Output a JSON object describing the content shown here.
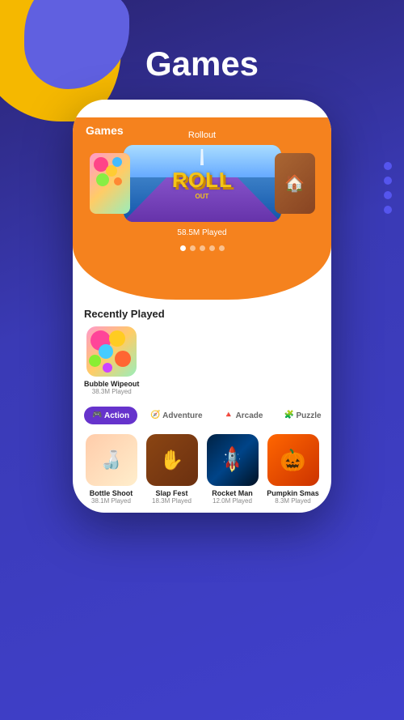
{
  "page": {
    "title": "Games",
    "background": "#3a3ab5"
  },
  "featured": {
    "game_label": "Rollout",
    "game_title": "ROLL",
    "game_subtitle": "OUT",
    "plays": "58.5M Played",
    "carousel_dots": [
      true,
      false,
      false,
      false,
      false
    ]
  },
  "recently_played": {
    "section_title": "Recently Played",
    "games": [
      {
        "name": "Bubble Wipeout",
        "plays": "38.3M Played"
      }
    ]
  },
  "categories": [
    {
      "label": "Action",
      "active": true,
      "icon": "🎮"
    },
    {
      "label": "Adventure",
      "active": false,
      "icon": "🧭"
    },
    {
      "label": "Arcade",
      "active": false,
      "icon": "🔺"
    },
    {
      "label": "Puzzle",
      "active": false,
      "icon": "🧩"
    }
  ],
  "games": [
    {
      "name": "Bottle Shoot",
      "plays": "38.1M Played",
      "type": "bottle"
    },
    {
      "name": "Slap Fest",
      "plays": "18.3M Played",
      "type": "slap"
    },
    {
      "name": "Rocket Man",
      "plays": "12.0M Played",
      "type": "rocket"
    },
    {
      "name": "Pumpkin Smas",
      "plays": "8.3M Played",
      "type": "pumpkin"
    }
  ],
  "phone_header_title": "Games"
}
